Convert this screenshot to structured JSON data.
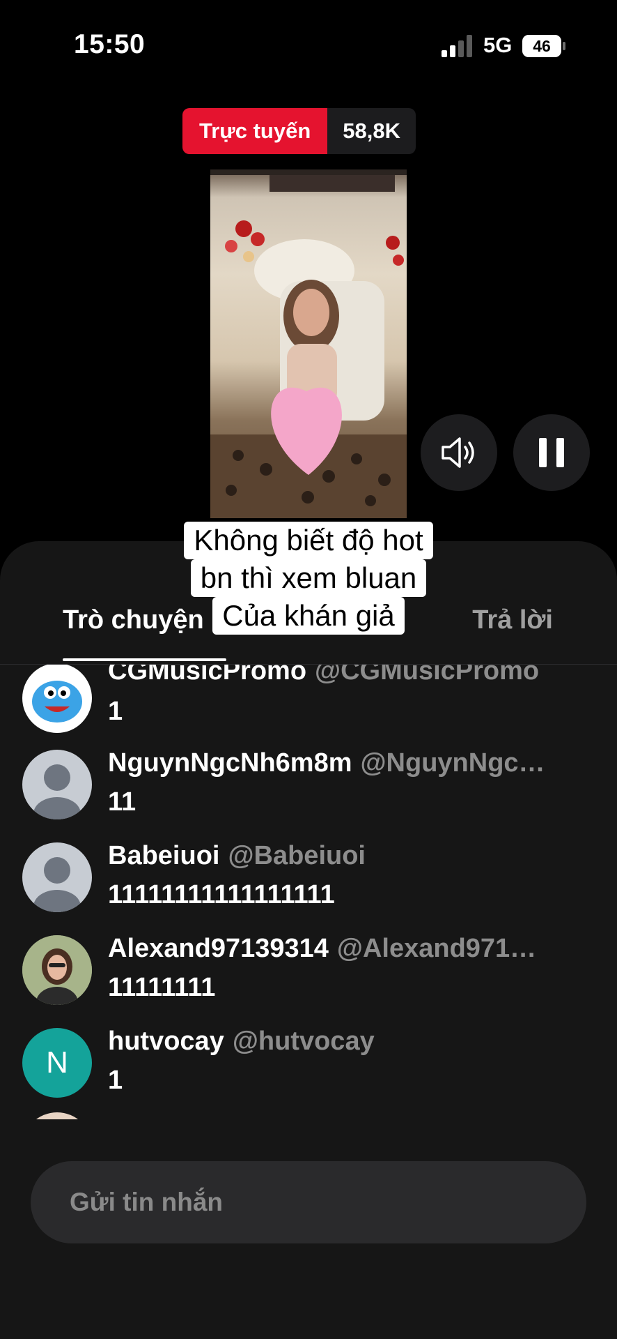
{
  "status_bar": {
    "time": "15:50",
    "network": "5G",
    "battery": "46"
  },
  "live": {
    "label": "Trực tuyến",
    "viewers": "58,8K"
  },
  "caption": [
    "Không biết độ hot",
    "bn thì xem bluan",
    "Của khán giả"
  ],
  "tabs": {
    "chat": "Trò chuyện",
    "reply": "Trả lời"
  },
  "messages": [
    {
      "name": "CGMusicPromo",
      "handle": "@CGMusicPromo",
      "text": "1",
      "avatar": "monster-avatar"
    },
    {
      "name": "NguynNgcNh6m8m",
      "handle": "@NguynNgc…",
      "text": "11",
      "avatar": "default-avatar"
    },
    {
      "name": "Babeiuoi",
      "handle": "@Babeiuoi",
      "text": "11111111111111111",
      "avatar": "default-avatar"
    },
    {
      "name": "Alexand97139314",
      "handle": "@Alexand971…",
      "text": "11111111",
      "avatar": "photo-avatar"
    },
    {
      "name": "hutvocay",
      "handle": "@hutvocay",
      "text": "1",
      "avatar": "letter-avatar",
      "initial": "N"
    }
  ],
  "composer": {
    "placeholder": "Gửi tin nhắn"
  },
  "colors": {
    "live_red": "#e5132f",
    "sheet": "#161616",
    "handle_gray": "#8d8d8d"
  }
}
